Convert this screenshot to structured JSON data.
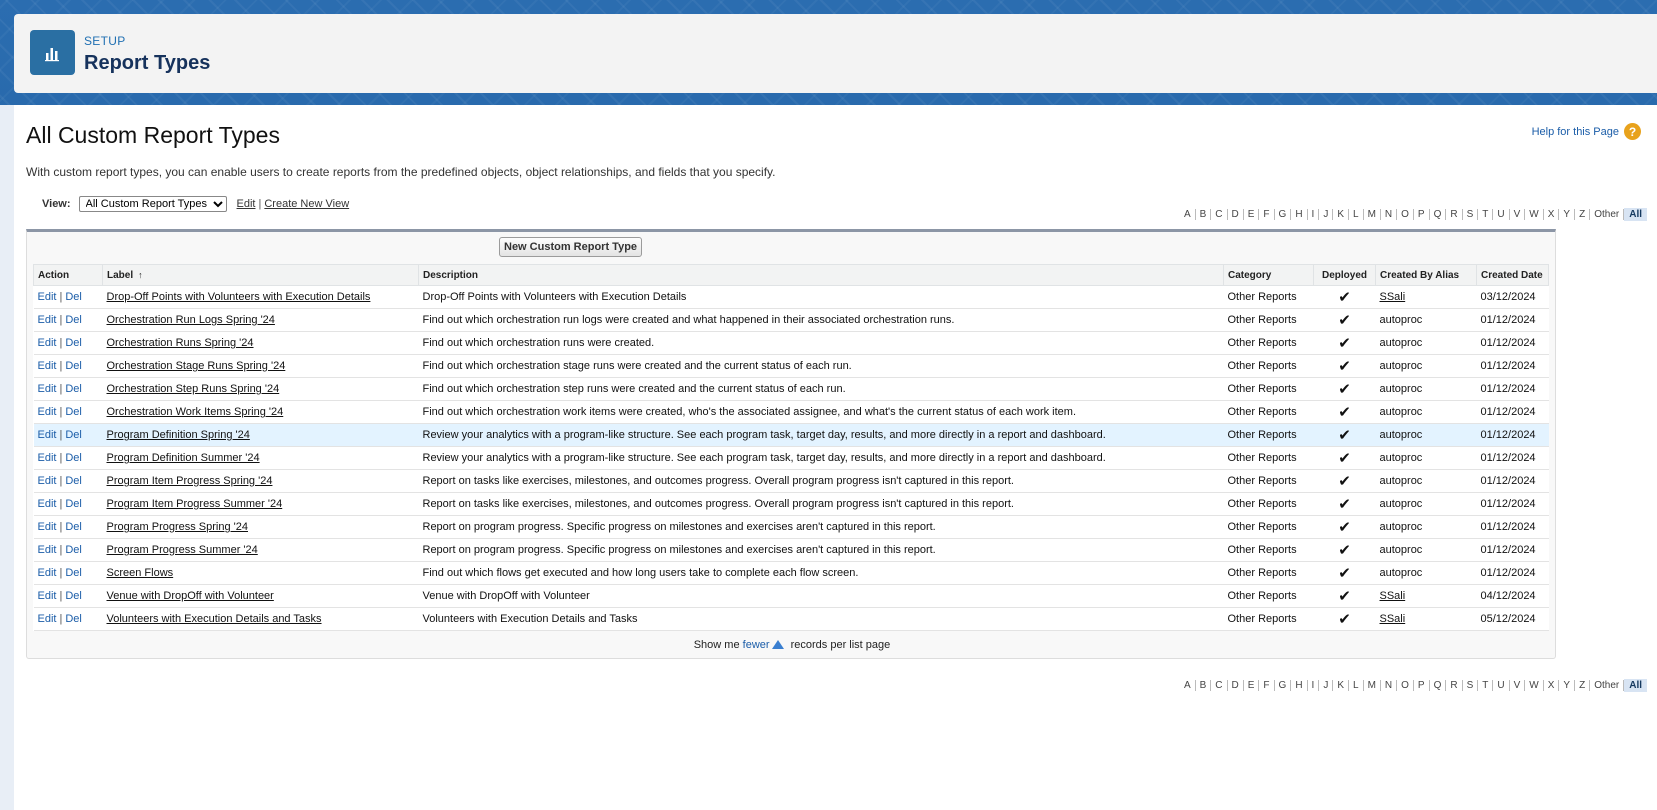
{
  "header": {
    "eyebrow": "SETUP",
    "title": "Report Types",
    "icon": "report-chart-icon"
  },
  "page": {
    "title": "All Custom Report Types",
    "help_link": "Help for this Page",
    "intro": "With custom report types, you can enable users to create reports from the predefined objects, object relationships, and fields that you specify."
  },
  "view": {
    "label": "View:",
    "selected": "All Custom Report Types",
    "edit_link": "Edit",
    "separator": "|",
    "create_link": "Create New View"
  },
  "alphabet": [
    "A",
    "B",
    "C",
    "D",
    "E",
    "F",
    "G",
    "H",
    "I",
    "J",
    "K",
    "L",
    "M",
    "N",
    "O",
    "P",
    "Q",
    "R",
    "S",
    "T",
    "U",
    "V",
    "W",
    "X",
    "Y",
    "Z",
    "Other",
    "All"
  ],
  "alphabet_active": "All",
  "new_button": "New Custom Report Type",
  "table": {
    "columns": [
      "Action",
      "Label",
      "Description",
      "Category",
      "Deployed",
      "Created By Alias",
      "Created Date"
    ],
    "sort_indicator": "↑",
    "action_edit": "Edit",
    "action_del": "Del",
    "action_sep": "|",
    "deployed_mark": "✔",
    "rows": [
      {
        "label": "Drop-Off Points with Volunteers with Execution Details",
        "description": "Drop-Off Points with Volunteers with Execution Details",
        "category": "Other Reports",
        "alias": "SSali",
        "alias_link": true,
        "date": "03/12/2024"
      },
      {
        "label": "Orchestration Run Logs Spring '24",
        "description": "Find out which orchestration run logs were created and what happened in their associated orchestration runs.",
        "category": "Other Reports",
        "alias": "autoproc",
        "alias_link": false,
        "date": "01/12/2024"
      },
      {
        "label": "Orchestration Runs Spring '24",
        "description": "Find out which orchestration runs were created.",
        "category": "Other Reports",
        "alias": "autoproc",
        "alias_link": false,
        "date": "01/12/2024"
      },
      {
        "label": "Orchestration Stage Runs Spring '24",
        "description": "Find out which orchestration stage runs were created and the current status of each run.",
        "category": "Other Reports",
        "alias": "autoproc",
        "alias_link": false,
        "date": "01/12/2024"
      },
      {
        "label": "Orchestration Step Runs Spring '24",
        "description": "Find out which orchestration step runs were created and the current status of each run.",
        "category": "Other Reports",
        "alias": "autoproc",
        "alias_link": false,
        "date": "01/12/2024"
      },
      {
        "label": "Orchestration Work Items Spring '24",
        "description": "Find out which orchestration work items were created, who's the associated assignee, and what's the current status of each work item.",
        "category": "Other Reports",
        "alias": "autoproc",
        "alias_link": false,
        "date": "01/12/2024"
      },
      {
        "label": "Program Definition Spring '24",
        "description": "Review your analytics with a program-like structure. See each program task, target day, results, and more directly in a report and dashboard.",
        "category": "Other Reports",
        "alias": "autoproc",
        "alias_link": false,
        "date": "01/12/2024"
      },
      {
        "label": "Program Definition Summer '24",
        "description": "Review your analytics with a program-like structure. See each program task, target day, results, and more directly in a report and dashboard.",
        "category": "Other Reports",
        "alias": "autoproc",
        "alias_link": false,
        "date": "01/12/2024"
      },
      {
        "label": "Program Item Progress Spring '24",
        "description": "Report on tasks like exercises, milestones, and outcomes progress. Overall program progress isn't captured in this report.",
        "category": "Other Reports",
        "alias": "autoproc",
        "alias_link": false,
        "date": "01/12/2024"
      },
      {
        "label": "Program Item Progress Summer '24",
        "description": "Report on tasks like exercises, milestones, and outcomes progress. Overall program progress isn't captured in this report.",
        "category": "Other Reports",
        "alias": "autoproc",
        "alias_link": false,
        "date": "01/12/2024"
      },
      {
        "label": "Program Progress Spring '24",
        "description": "Report on program progress. Specific progress on milestones and exercises aren't captured in this report.",
        "category": "Other Reports",
        "alias": "autoproc",
        "alias_link": false,
        "date": "01/12/2024"
      },
      {
        "label": "Program Progress Summer '24",
        "description": "Report on program progress. Specific progress on milestones and exercises aren't captured in this report.",
        "category": "Other Reports",
        "alias": "autoproc",
        "alias_link": false,
        "date": "01/12/2024"
      },
      {
        "label": "Screen Flows",
        "description": "Find out which flows get executed and how long users take to complete each flow screen.",
        "category": "Other Reports",
        "alias": "autoproc",
        "alias_link": false,
        "date": "01/12/2024"
      },
      {
        "label": "Venue with DropOff with Volunteer",
        "description": "Venue with DropOff with Volunteer",
        "category": "Other Reports",
        "alias": "SSali",
        "alias_link": true,
        "date": "04/12/2024"
      },
      {
        "label": "Volunteers with Execution Details and Tasks",
        "description": "Volunteers with Execution Details and Tasks",
        "category": "Other Reports",
        "alias": "SSali",
        "alias_link": true,
        "date": "05/12/2024"
      }
    ],
    "highlighted_row": 6
  },
  "footer": {
    "show_me": "Show me",
    "fewer": "fewer",
    "records_text": "records per list page"
  },
  "colors": {
    "brand_blue": "#2a6fa3",
    "link_blue": "#1b5da8",
    "row_highlight": "#e3f3ff",
    "help_orange": "#e8a21c"
  }
}
